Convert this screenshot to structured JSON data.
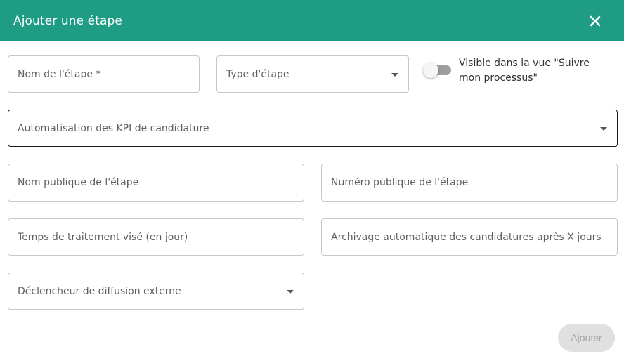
{
  "dialog": {
    "title": "Ajouter une étape",
    "close_icon": "close-icon"
  },
  "fields": {
    "step_name": {
      "placeholder": "Nom de l'étape *"
    },
    "step_type": {
      "placeholder": "Type d'étape"
    },
    "visibility_toggle": {
      "label": "Visible dans la vue \"Suivre mon processus\"",
      "checked": false
    },
    "kpi_automation": {
      "placeholder": "Automatisation des KPI de candidature"
    },
    "public_name": {
      "placeholder": "Nom publique de l'étape"
    },
    "public_number": {
      "placeholder": "Numéro publique de l'étape"
    },
    "processing_time": {
      "placeholder": "Temps de traitement visé (en jour)"
    },
    "auto_archive": {
      "placeholder": "Archivage automatique des candidatures après X jours"
    },
    "external_trigger": {
      "placeholder": "Déclencheur de diffusion externe"
    }
  },
  "actions": {
    "submit_label": "Ajouter"
  },
  "colors": {
    "header_bg": "#1e9d84",
    "disabled_button_bg": "#e0e0e0"
  }
}
